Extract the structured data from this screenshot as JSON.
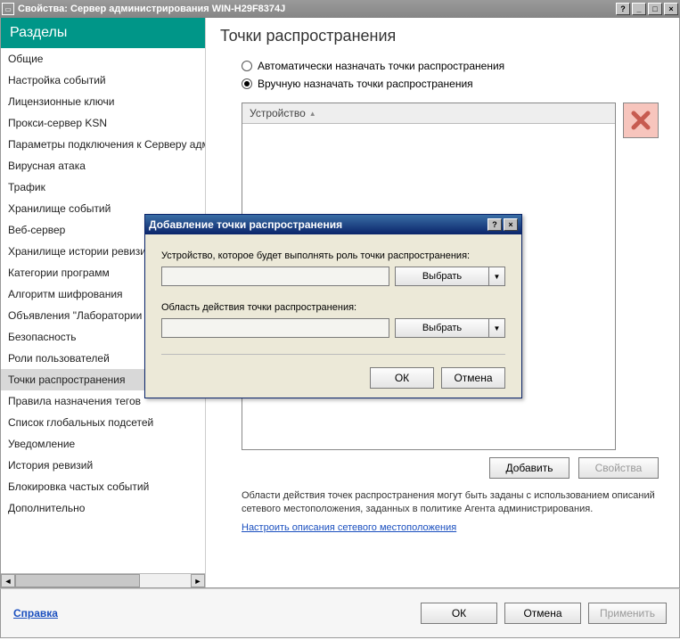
{
  "window": {
    "title": "Свойства: Сервер администрирования WIN-H29F8374J",
    "help_btn": "?",
    "min_btn": "_",
    "max_btn": "□",
    "close_btn": "×"
  },
  "sidebar": {
    "header": "Разделы",
    "items": [
      {
        "label": "Общие"
      },
      {
        "label": "Настройка событий"
      },
      {
        "label": "Лицензионные ключи"
      },
      {
        "label": "Прокси-сервер KSN"
      },
      {
        "label": "Параметры подключения к Серверу админи"
      },
      {
        "label": "Вирусная атака"
      },
      {
        "label": "Трафик"
      },
      {
        "label": "Хранилище событий"
      },
      {
        "label": "Веб-сервер"
      },
      {
        "label": "Хранилище истории ревизий"
      },
      {
        "label": "Категории программ"
      },
      {
        "label": "Алгоритм шифрования"
      },
      {
        "label": "Объявления \"Лаборатории Кас"
      },
      {
        "label": "Безопасность"
      },
      {
        "label": "Роли пользователей"
      },
      {
        "label": "Точки распространения"
      },
      {
        "label": "Правила назначения тегов"
      },
      {
        "label": "Список глобальных подсетей"
      },
      {
        "label": "Уведомление"
      },
      {
        "label": "История ревизий"
      },
      {
        "label": "Блокировка частых событий"
      },
      {
        "label": "Дополнительно"
      }
    ],
    "active_index": 15,
    "scroll_left": "◄",
    "scroll_right": "►"
  },
  "content": {
    "title": "Точки распространения",
    "radio_auto": "Автоматически назначать точки распространения",
    "radio_manual": "Вручную назначать точки распространения",
    "list_header": "Устройство",
    "list_sort_glyph": "▲",
    "add_btn": "Добавить",
    "props_btn": "Свойства",
    "note": "Области действия точек распространения могут быть заданы с использованием описаний сетевого местоположения, заданных в политике Агента администрирования.",
    "link": "Настроить описания сетевого местоположения"
  },
  "footer": {
    "help": "Справка",
    "ok": "ОК",
    "cancel": "Отмена",
    "apply": "Применить"
  },
  "dialog": {
    "title": "Добавление точки распространения",
    "help_btn": "?",
    "close_btn": "×",
    "lbl_device": "Устройство, которое будет выполнять роль точки распространения:",
    "lbl_scope": "Область действия точки распространения:",
    "select": "Выбрать",
    "dropdown_glyph": "▼",
    "ok": "ОК",
    "cancel": "Отмена"
  }
}
